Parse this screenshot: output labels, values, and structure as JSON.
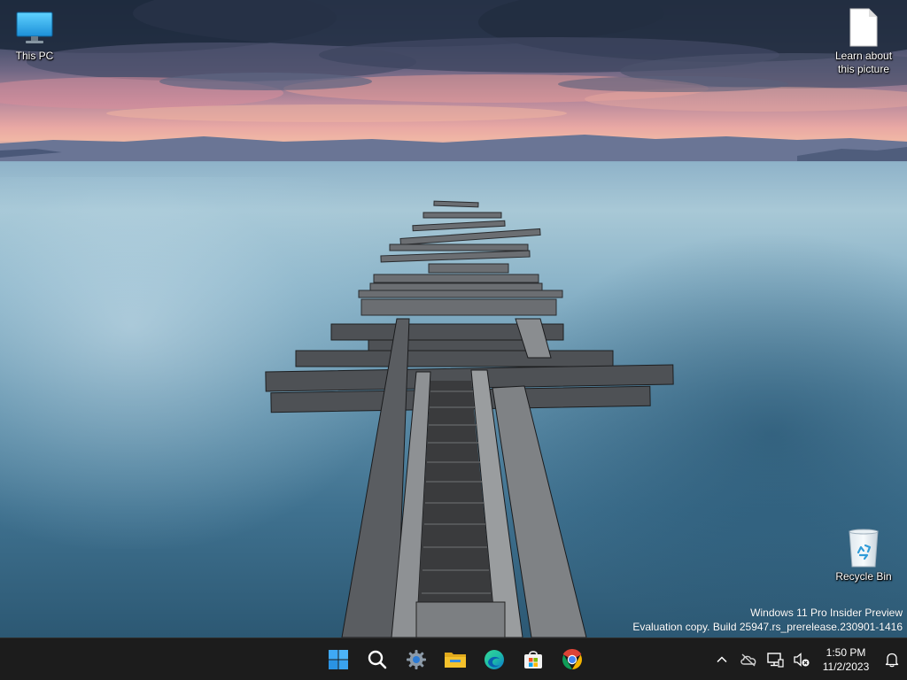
{
  "desktop": {
    "icons": [
      {
        "label": "This PC",
        "icon": "this-pc-icon"
      },
      {
        "label": "Learn about\nthis picture",
        "icon": "document-icon"
      },
      {
        "label": "Recycle Bin",
        "icon": "recycle-bin-icon"
      }
    ]
  },
  "watermark": {
    "line1": "Windows 11 Pro Insider Preview",
    "line2": "Evaluation copy. Build 25947.rs_prerelease.230901-1416"
  },
  "taskbar": {
    "apps": [
      {
        "name": "Start",
        "icon": "windows-start-icon"
      },
      {
        "name": "Search",
        "icon": "search-icon"
      },
      {
        "name": "Settings",
        "icon": "gear-icon"
      },
      {
        "name": "File Explorer",
        "icon": "folder-icon"
      },
      {
        "name": "Microsoft Edge",
        "icon": "edge-icon"
      },
      {
        "name": "Microsoft Store",
        "icon": "store-icon"
      },
      {
        "name": "Google Chrome",
        "icon": "chrome-icon"
      }
    ],
    "tray": {
      "icons": [
        "chevron-up-icon",
        "onedrive-icon",
        "network-icon",
        "volume-muted-icon",
        "bell-icon"
      ],
      "time": "1:50 PM",
      "date": "11/2/2023"
    }
  },
  "colors": {
    "taskbar_bg": "#1c1c1c",
    "start_blue": "#3fa9f5",
    "folder_yellow": "#f4c12c",
    "edge_teal": "#1ebea5",
    "chrome_red": "#db4437",
    "chrome_yellow": "#f4b400",
    "chrome_green": "#0f9d58",
    "chrome_blue": "#4285f4"
  }
}
